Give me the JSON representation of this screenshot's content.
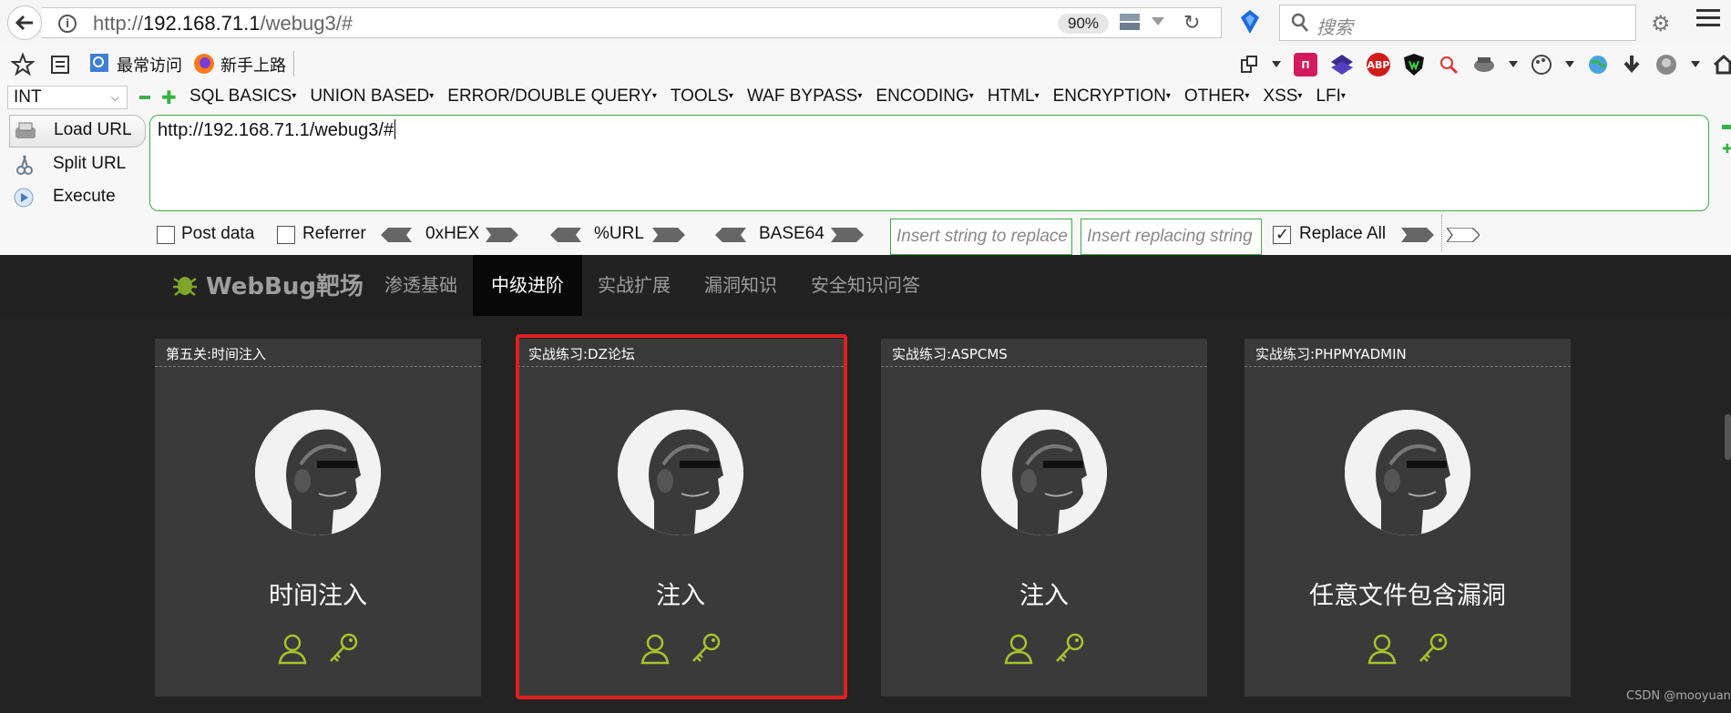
{
  "browser": {
    "url_prefix": "http://",
    "url_host": "192.168.71.1",
    "url_path": "/webug3/#",
    "zoom": "90%",
    "search_placeholder": "搜索"
  },
  "bookmarks": {
    "most_visited": "最常访问",
    "getting_started": "新手上路"
  },
  "toolbar_icons": {
    "abp": "ABP",
    "js": "JS"
  },
  "hackbar": {
    "select_value": "INT",
    "menus": [
      "SQL BASICS",
      "UNION BASED",
      "ERROR/DOUBLE QUERY",
      "TOOLS",
      "WAF BYPASS",
      "ENCODING",
      "HTML",
      "ENCRYPTION",
      "OTHER",
      "XSS",
      "LFI"
    ],
    "load_url": "Load URL",
    "split_url": "Split URL",
    "execute": "Execute",
    "textarea_value": "http://192.168.71.1/webug3/#",
    "post_data": "Post data",
    "referrer": "Referrer",
    "hex": "0xHEX",
    "urlenc": "%URL",
    "base64": "BASE64",
    "insert_placeholder": "Insert string to replace",
    "replacing_placeholder": "Insert replacing string",
    "replace_all": "Replace All",
    "replace_all_checked": true
  },
  "site": {
    "brand": "WebBug靶场",
    "nav": [
      "渗透基础",
      "中级进阶",
      "实战扩展",
      "漏洞知识",
      "安全知识问答"
    ],
    "active_nav": "中级进阶"
  },
  "cards": [
    {
      "header": "第五关:时间注入",
      "title": "时间注入"
    },
    {
      "header": "实战练习:DZ论坛",
      "title": "注入"
    },
    {
      "header": "实战练习:ASPCMS",
      "title": "注入"
    },
    {
      "header": "实战练习:PHPMYADMIN",
      "title": "任意文件包含漏洞"
    }
  ],
  "watermark": "CSDN @mooyuan",
  "colors": {
    "accent_green": "#a6c42b",
    "highlight_red": "#e02020",
    "hackbar_green": "#3fa94a"
  }
}
